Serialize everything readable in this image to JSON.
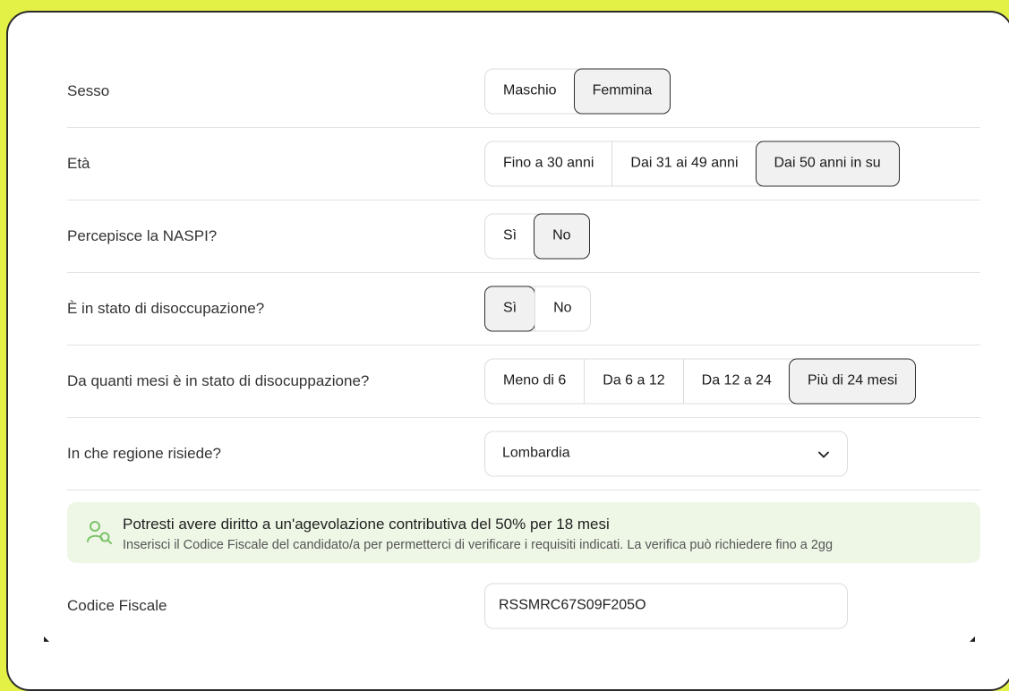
{
  "colors": {
    "background": "#e3f046",
    "card": "#ffffff",
    "selected": "#f1f1f1",
    "info_bg": "#eef7e6",
    "info_icon": "#7cc36a"
  },
  "rows": {
    "sesso": {
      "label": "Sesso",
      "options": [
        "Maschio",
        "Femmina"
      ],
      "selected": "Femmina"
    },
    "eta": {
      "label": "Età",
      "options": [
        "Fino a 30 anni",
        "Dai 31 ai 49 anni",
        "Dai 50 anni in su"
      ],
      "selected": "Dai 50 anni in su"
    },
    "naspi": {
      "label": "Percepisce la NASPI?",
      "options": [
        "Sì",
        "No"
      ],
      "selected": "No"
    },
    "disoccupazione": {
      "label": "È in stato di disoccupazione?",
      "options": [
        "Sì",
        "No"
      ],
      "selected": "Sì"
    },
    "mesi": {
      "label": "Da quanti mesi è in stato di disocuppazione?",
      "options": [
        "Meno di 6",
        "Da 6 a 12",
        "Da 12 a 24",
        "Più di 24 mesi"
      ],
      "selected": "Più di 24 mesi"
    },
    "regione": {
      "label": "In che regione risiede?",
      "value": "Lombardia",
      "icon": "chevron-down-icon"
    }
  },
  "info": {
    "icon": "user-search-icon",
    "title": "Potresti avere diritto a un'agevolazione contributiva del 50% per 18 mesi",
    "text": "Inserisci il Codice Fiscale del candidato/a per permetterci di verificare i requisiti indicati. La verifica può richiedere fino a 2gg"
  },
  "codice": {
    "label": "Codice Fiscale",
    "value": "RSSMRC67S09F205O"
  }
}
